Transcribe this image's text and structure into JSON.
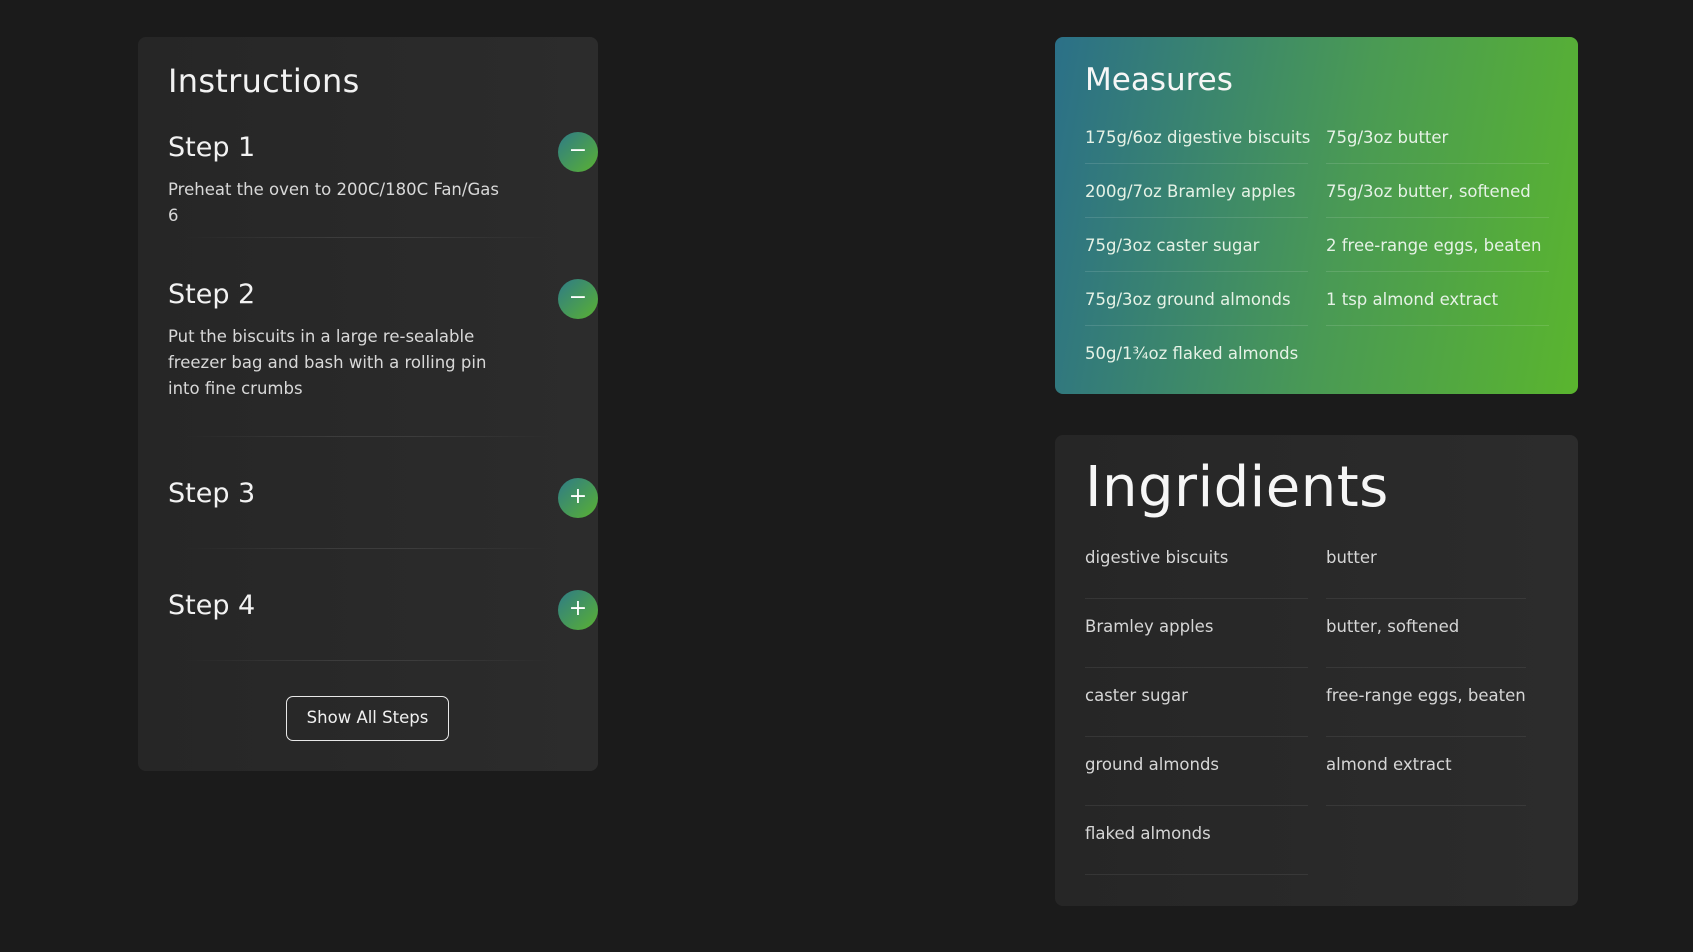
{
  "instructions": {
    "title": "Instructions",
    "steps": [
      {
        "title": "Step 1",
        "text": "Preheat the oven to 200C/180C Fan/Gas 6",
        "toggle": "−"
      },
      {
        "title": "Step 2",
        "text": "Put the biscuits in a large re-sealable freezer bag and bash with a rolling pin into fine crumbs",
        "toggle": "−"
      },
      {
        "title": "Step 3",
        "text": "",
        "toggle": "+"
      },
      {
        "title": "Step 4",
        "text": "",
        "toggle": "+"
      }
    ],
    "show_all_label": "Show All Steps"
  },
  "measures": {
    "title": "Measures",
    "items": [
      "175g/6oz digestive biscuits",
      "75g/3oz butter",
      "200g/7oz Bramley apples",
      "75g/3oz butter, softened",
      "75g/3oz caster sugar",
      "2 free-range eggs, beaten",
      "75g/3oz ground almonds",
      "1 tsp almond extract",
      "50g/1¾oz flaked almonds"
    ]
  },
  "ingredients": {
    "title": "Ingridients",
    "items": [
      "digestive biscuits",
      "butter",
      "Bramley apples",
      "butter, softened",
      "caster sugar",
      "free-range eggs, beaten",
      "ground almonds",
      "almond extract",
      "flaked almonds"
    ]
  },
  "colors": {
    "background": "#1b1b1b",
    "card": "#2a2a2a",
    "accent_gradient_start": "#2b7088",
    "accent_gradient_end": "#5ab52e"
  }
}
